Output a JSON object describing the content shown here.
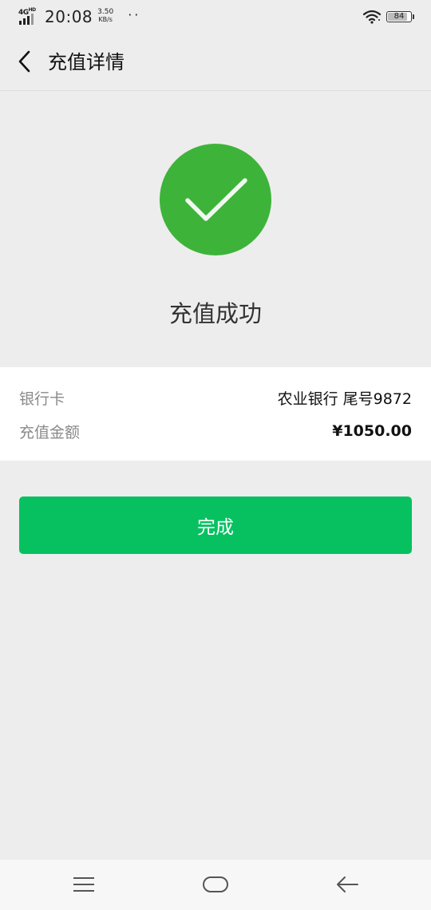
{
  "status_bar": {
    "network": "4G",
    "network_suffix": "HD",
    "time": "20:08",
    "speed_value": "3.50",
    "speed_unit": "KB/s",
    "battery": "84",
    "battery_level": 0.84
  },
  "nav": {
    "title": "充值详情"
  },
  "success": {
    "title": "充值成功",
    "color": "#3eb33a"
  },
  "details": {
    "bank_label": "银行卡",
    "bank_value": "农业银行 尾号9872",
    "amount_label": "充值金额",
    "amount_value": "¥1050.00"
  },
  "actions": {
    "done_label": "完成",
    "done_color": "#07c160"
  },
  "icons": {
    "back": "chevron-left-icon",
    "check": "check-icon",
    "wifi": "wifi-icon",
    "battery": "battery-icon",
    "menu": "menu-icon",
    "home": "home-icon",
    "system_back": "arrow-left-icon"
  }
}
